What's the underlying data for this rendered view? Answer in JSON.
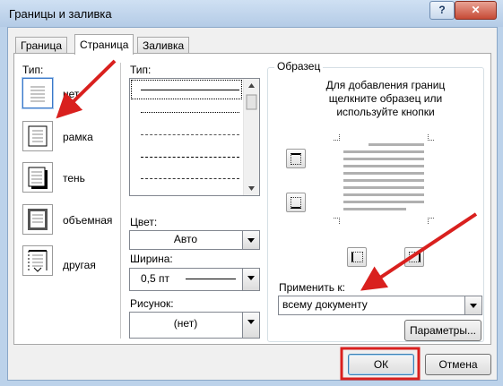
{
  "window": {
    "title": "Границы и заливка",
    "help_label": "?",
    "close_label": "✕"
  },
  "tabs": [
    {
      "label": "Граница"
    },
    {
      "label": "Страница"
    },
    {
      "label": "Заливка"
    }
  ],
  "setting": {
    "label": "Тип:",
    "items": [
      {
        "label": "нет",
        "icon": "none-setting-icon"
      },
      {
        "label": "рамка",
        "icon": "box-setting-icon"
      },
      {
        "label": "тень",
        "icon": "shadow-setting-icon"
      },
      {
        "label": "объемная",
        "icon": "3d-setting-icon"
      },
      {
        "label": "другая",
        "icon": "custom-setting-icon"
      }
    ]
  },
  "style": {
    "label": "Тип:",
    "lines": [
      "solid",
      "dotted",
      "dashed",
      "long-dashed",
      "dash-dot"
    ]
  },
  "color": {
    "label": "Цвет:",
    "value": "Авто"
  },
  "width": {
    "label": "Ширина:",
    "value": "0,5 пт"
  },
  "art": {
    "label": "Рисунок:",
    "value": "(нет)"
  },
  "preview": {
    "label": "Образец",
    "description": "Для добавления границ щелкните образец или используйте кнопки"
  },
  "apply_to": {
    "label": "Применить к:",
    "value": "всему документу"
  },
  "buttons": {
    "options": "Параметры...",
    "ok": "ОК",
    "cancel": "Отмена"
  },
  "annotation_color": "#d9201e"
}
